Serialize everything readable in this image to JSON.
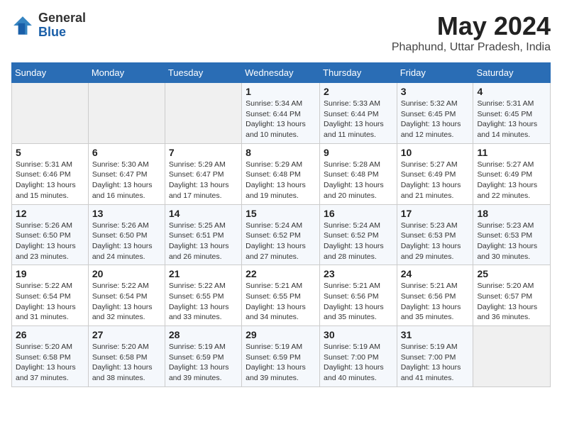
{
  "logo": {
    "general": "General",
    "blue": "Blue"
  },
  "header": {
    "month_year": "May 2024",
    "location": "Phaphund, Uttar Pradesh, India"
  },
  "weekdays": [
    "Sunday",
    "Monday",
    "Tuesday",
    "Wednesday",
    "Thursday",
    "Friday",
    "Saturday"
  ],
  "weeks": [
    [
      {
        "day": "",
        "sunrise": "",
        "sunset": "",
        "daylight": ""
      },
      {
        "day": "",
        "sunrise": "",
        "sunset": "",
        "daylight": ""
      },
      {
        "day": "",
        "sunrise": "",
        "sunset": "",
        "daylight": ""
      },
      {
        "day": "1",
        "sunrise": "Sunrise: 5:34 AM",
        "sunset": "Sunset: 6:44 PM",
        "daylight": "Daylight: 13 hours and 10 minutes."
      },
      {
        "day": "2",
        "sunrise": "Sunrise: 5:33 AM",
        "sunset": "Sunset: 6:44 PM",
        "daylight": "Daylight: 13 hours and 11 minutes."
      },
      {
        "day": "3",
        "sunrise": "Sunrise: 5:32 AM",
        "sunset": "Sunset: 6:45 PM",
        "daylight": "Daylight: 13 hours and 12 minutes."
      },
      {
        "day": "4",
        "sunrise": "Sunrise: 5:31 AM",
        "sunset": "Sunset: 6:45 PM",
        "daylight": "Daylight: 13 hours and 14 minutes."
      }
    ],
    [
      {
        "day": "5",
        "sunrise": "Sunrise: 5:31 AM",
        "sunset": "Sunset: 6:46 PM",
        "daylight": "Daylight: 13 hours and 15 minutes."
      },
      {
        "day": "6",
        "sunrise": "Sunrise: 5:30 AM",
        "sunset": "Sunset: 6:47 PM",
        "daylight": "Daylight: 13 hours and 16 minutes."
      },
      {
        "day": "7",
        "sunrise": "Sunrise: 5:29 AM",
        "sunset": "Sunset: 6:47 PM",
        "daylight": "Daylight: 13 hours and 17 minutes."
      },
      {
        "day": "8",
        "sunrise": "Sunrise: 5:29 AM",
        "sunset": "Sunset: 6:48 PM",
        "daylight": "Daylight: 13 hours and 19 minutes."
      },
      {
        "day": "9",
        "sunrise": "Sunrise: 5:28 AM",
        "sunset": "Sunset: 6:48 PM",
        "daylight": "Daylight: 13 hours and 20 minutes."
      },
      {
        "day": "10",
        "sunrise": "Sunrise: 5:27 AM",
        "sunset": "Sunset: 6:49 PM",
        "daylight": "Daylight: 13 hours and 21 minutes."
      },
      {
        "day": "11",
        "sunrise": "Sunrise: 5:27 AM",
        "sunset": "Sunset: 6:49 PM",
        "daylight": "Daylight: 13 hours and 22 minutes."
      }
    ],
    [
      {
        "day": "12",
        "sunrise": "Sunrise: 5:26 AM",
        "sunset": "Sunset: 6:50 PM",
        "daylight": "Daylight: 13 hours and 23 minutes."
      },
      {
        "day": "13",
        "sunrise": "Sunrise: 5:26 AM",
        "sunset": "Sunset: 6:50 PM",
        "daylight": "Daylight: 13 hours and 24 minutes."
      },
      {
        "day": "14",
        "sunrise": "Sunrise: 5:25 AM",
        "sunset": "Sunset: 6:51 PM",
        "daylight": "Daylight: 13 hours and 26 minutes."
      },
      {
        "day": "15",
        "sunrise": "Sunrise: 5:24 AM",
        "sunset": "Sunset: 6:52 PM",
        "daylight": "Daylight: 13 hours and 27 minutes."
      },
      {
        "day": "16",
        "sunrise": "Sunrise: 5:24 AM",
        "sunset": "Sunset: 6:52 PM",
        "daylight": "Daylight: 13 hours and 28 minutes."
      },
      {
        "day": "17",
        "sunrise": "Sunrise: 5:23 AM",
        "sunset": "Sunset: 6:53 PM",
        "daylight": "Daylight: 13 hours and 29 minutes."
      },
      {
        "day": "18",
        "sunrise": "Sunrise: 5:23 AM",
        "sunset": "Sunset: 6:53 PM",
        "daylight": "Daylight: 13 hours and 30 minutes."
      }
    ],
    [
      {
        "day": "19",
        "sunrise": "Sunrise: 5:22 AM",
        "sunset": "Sunset: 6:54 PM",
        "daylight": "Daylight: 13 hours and 31 minutes."
      },
      {
        "day": "20",
        "sunrise": "Sunrise: 5:22 AM",
        "sunset": "Sunset: 6:54 PM",
        "daylight": "Daylight: 13 hours and 32 minutes."
      },
      {
        "day": "21",
        "sunrise": "Sunrise: 5:22 AM",
        "sunset": "Sunset: 6:55 PM",
        "daylight": "Daylight: 13 hours and 33 minutes."
      },
      {
        "day": "22",
        "sunrise": "Sunrise: 5:21 AM",
        "sunset": "Sunset: 6:55 PM",
        "daylight": "Daylight: 13 hours and 34 minutes."
      },
      {
        "day": "23",
        "sunrise": "Sunrise: 5:21 AM",
        "sunset": "Sunset: 6:56 PM",
        "daylight": "Daylight: 13 hours and 35 minutes."
      },
      {
        "day": "24",
        "sunrise": "Sunrise: 5:21 AM",
        "sunset": "Sunset: 6:56 PM",
        "daylight": "Daylight: 13 hours and 35 minutes."
      },
      {
        "day": "25",
        "sunrise": "Sunrise: 5:20 AM",
        "sunset": "Sunset: 6:57 PM",
        "daylight": "Daylight: 13 hours and 36 minutes."
      }
    ],
    [
      {
        "day": "26",
        "sunrise": "Sunrise: 5:20 AM",
        "sunset": "Sunset: 6:58 PM",
        "daylight": "Daylight: 13 hours and 37 minutes."
      },
      {
        "day": "27",
        "sunrise": "Sunrise: 5:20 AM",
        "sunset": "Sunset: 6:58 PM",
        "daylight": "Daylight: 13 hours and 38 minutes."
      },
      {
        "day": "28",
        "sunrise": "Sunrise: 5:19 AM",
        "sunset": "Sunset: 6:59 PM",
        "daylight": "Daylight: 13 hours and 39 minutes."
      },
      {
        "day": "29",
        "sunrise": "Sunrise: 5:19 AM",
        "sunset": "Sunset: 6:59 PM",
        "daylight": "Daylight: 13 hours and 39 minutes."
      },
      {
        "day": "30",
        "sunrise": "Sunrise: 5:19 AM",
        "sunset": "Sunset: 7:00 PM",
        "daylight": "Daylight: 13 hours and 40 minutes."
      },
      {
        "day": "31",
        "sunrise": "Sunrise: 5:19 AM",
        "sunset": "Sunset: 7:00 PM",
        "daylight": "Daylight: 13 hours and 41 minutes."
      },
      {
        "day": "",
        "sunrise": "",
        "sunset": "",
        "daylight": ""
      }
    ]
  ]
}
